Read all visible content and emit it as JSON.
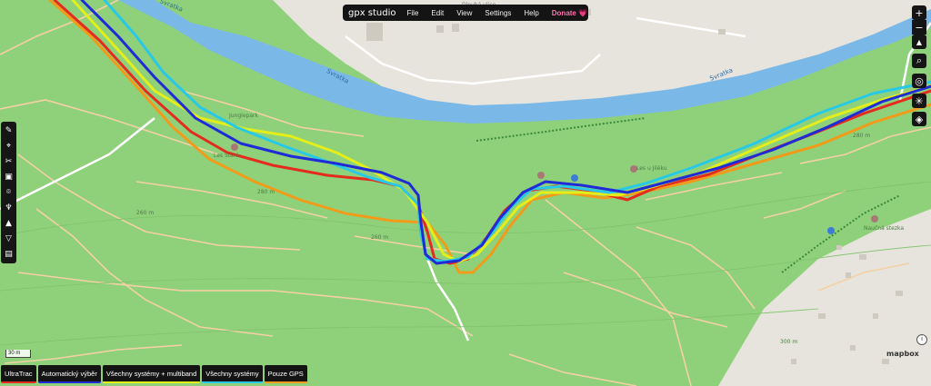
{
  "app": {
    "logo_text": "gpx studio",
    "menu": [
      "File",
      "Edit",
      "View",
      "Settings",
      "Help"
    ],
    "donate_label": "Donate 💗"
  },
  "map": {
    "labels": {
      "river_1": "Svratka",
      "river_2": "Svratka",
      "river_3": "Svratka",
      "park": "Junglepark",
      "les_1": "Les Staré",
      "les_2": "Les u Jiléku",
      "trail": "Naučná stezka",
      "contour_1": "280 m",
      "contour_2": "260 m",
      "contour_3": "260 m",
      "contour_4": "280 m",
      "contour_5": "300 m",
      "road_top": "Dlouhá ulice"
    },
    "colors": {
      "meadow": "#8fd17a",
      "river": "#7ab8e8",
      "urban": "#e6e4dc",
      "path": "#f5d0a6"
    }
  },
  "left_toolbar": {
    "tools": [
      {
        "name": "pencil-icon",
        "glyph": "✎"
      },
      {
        "name": "map-pin-icon",
        "glyph": "⌖"
      },
      {
        "name": "scissors-icon",
        "glyph": "✂"
      },
      {
        "name": "calendar-icon",
        "glyph": "▣"
      },
      {
        "name": "target-icon",
        "glyph": "⌾"
      },
      {
        "name": "route-icon",
        "glyph": "♆"
      },
      {
        "name": "mountain-icon",
        "glyph": "▲"
      },
      {
        "name": "filter-icon",
        "glyph": "▽"
      },
      {
        "name": "note-icon",
        "glyph": "▤"
      }
    ]
  },
  "map_controls": {
    "zoom_in": "+",
    "zoom_out": "−",
    "compass": "▲",
    "search": "⌕",
    "locate": "◎",
    "person": "✳",
    "layers": "◈"
  },
  "scale": "30 m",
  "legend": [
    {
      "label": "UltraTrac",
      "color": "#e52b1d"
    },
    {
      "label": "Automatický výběr",
      "color": "#1f2bd6"
    },
    {
      "label": "Všechny systémy + multiband",
      "color": "#e4ef1a"
    },
    {
      "label": "Všechny systémy",
      "color": "#27c9e6"
    },
    {
      "label": "Pouze GPS",
      "color": "#f29a19"
    }
  ],
  "attribution": "mapbox",
  "info_icon": "i"
}
